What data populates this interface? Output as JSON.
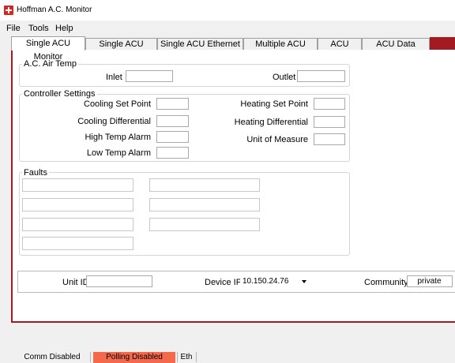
{
  "window": {
    "title": "Hoffman A.C. Monitor"
  },
  "menu": [
    "File",
    "Tools",
    "Help"
  ],
  "tabs": [
    "Single ACU Monitor",
    "Single ACU Settings",
    "Single ACU Ethernet Info",
    "Multiple ACU Monitor",
    "ACU Faults",
    "ACU Data Logging"
  ],
  "air_temp": {
    "group_label": "A.C. Air Temp",
    "inlet_label": "Inlet",
    "outlet_label": "Outlet"
  },
  "controller": {
    "group_label": "Controller Settings",
    "cooling_set_point": "Cooling Set Point",
    "cooling_differential": "Cooling Differential",
    "high_temp_alarm": "High Temp Alarm",
    "low_temp_alarm": "Low Temp Alarm",
    "heating_set_point": "Heating Set Point",
    "heating_differential": "Heating Differential",
    "unit_of_measure": "Unit of Measure"
  },
  "faults": {
    "group_label": "Faults"
  },
  "connection": {
    "unit_id_label": "Unit ID",
    "device_ip_label": "Device IP",
    "device_ip_value": "10.150.24.76",
    "community_label": "Community",
    "community_value": "private"
  },
  "status": {
    "comm": "Comm Disabled",
    "polling": "Polling Disabled",
    "mode": "Eth"
  },
  "colors": {
    "accent": "#a31a22",
    "polling_bg": "#f4694b",
    "app_icon": "#d9251d"
  },
  "icons": [
    "app-logo-icon",
    "dropdown-caret-icon"
  ]
}
